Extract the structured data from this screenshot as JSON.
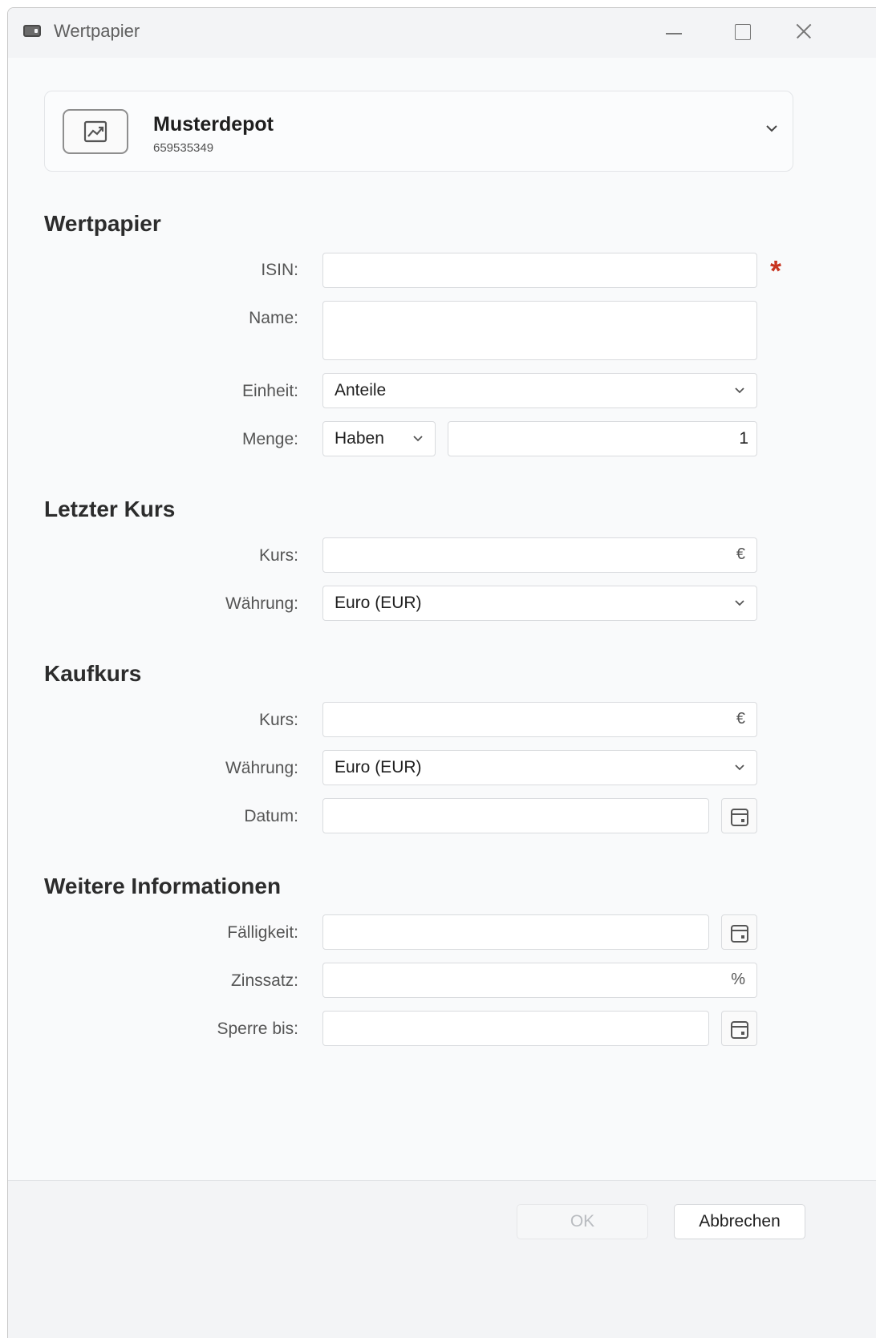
{
  "window": {
    "title": "Wertpapier"
  },
  "account": {
    "name": "Musterdepot",
    "number": "659535349"
  },
  "sections": {
    "security": "Wertpapier",
    "last_price": "Letzter Kurs",
    "purchase_price": "Kaufkurs",
    "more_info": "Weitere Informationen"
  },
  "labels": {
    "isin": "ISIN:",
    "name": "Name:",
    "unit": "Einheit:",
    "quantity": "Menge:",
    "last_price": "Kurs:",
    "last_currency": "Währung:",
    "purchase_price": "Kurs:",
    "purchase_currency": "Währung:",
    "date": "Datum:",
    "maturity": "Fälligkeit:",
    "interest_rate": "Zinssatz:",
    "blocked_until": "Sperre bis:"
  },
  "values": {
    "isin": "",
    "name": "",
    "unit": "Anteile",
    "quantity_side": "Haben",
    "quantity": "1",
    "last_price": "",
    "last_price_unit": "€",
    "last_currency": "Euro (EUR)",
    "purchase_price": "",
    "purchase_price_unit": "€",
    "purchase_currency": "Euro (EUR)",
    "date": "",
    "maturity": "",
    "interest_rate": "",
    "interest_rate_unit": "%",
    "blocked_until": ""
  },
  "required_marker": "*",
  "buttons": {
    "ok": "OK",
    "cancel": "Abbrechen"
  },
  "colors": {
    "required": "#c8341f",
    "window_bg": "#f9fafb",
    "field_border": "#d9dbde"
  },
  "icons": {
    "window": "window-icon",
    "account": "chart-trend-icon",
    "dropdown": "chevron-down-icon",
    "calendar": "calendar-icon"
  }
}
